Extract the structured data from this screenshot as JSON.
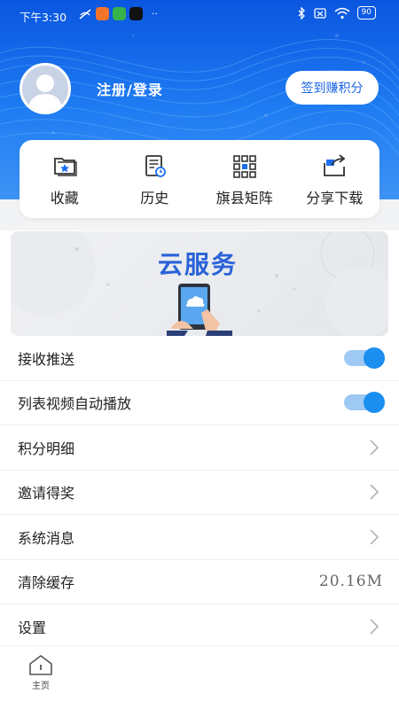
{
  "status_bar": {
    "time": "下午3:30",
    "battery": "90",
    "more": "··"
  },
  "user": {
    "login_text": "注册/登录",
    "signin_button": "签到赚积分"
  },
  "quick_actions": [
    {
      "label": "收藏",
      "icon": "favorites-folder-icon"
    },
    {
      "label": "历史",
      "icon": "history-icon"
    },
    {
      "label": "旗县矩阵",
      "icon": "grid-matrix-icon"
    },
    {
      "label": "分享下载",
      "icon": "share-icon"
    }
  ],
  "banner": {
    "title": "云服务"
  },
  "settings": [
    {
      "label": "接收推送",
      "control": "toggle",
      "on": true
    },
    {
      "label": "列表视频自动播放",
      "control": "toggle",
      "on": true
    },
    {
      "label": "积分明细",
      "control": "chevron"
    },
    {
      "label": "邀请得奖",
      "control": "chevron"
    },
    {
      "label": "系统消息",
      "control": "chevron"
    },
    {
      "label": "清除缓存",
      "control": "value",
      "value": "20.16M"
    },
    {
      "label": "设置",
      "control": "chevron"
    }
  ],
  "bottom_nav": {
    "home_label": "主页"
  },
  "colors": {
    "header_blue": "#1f7cf2",
    "accent_blue": "#1b8ff0",
    "toggle_track": "#9ec9f2"
  }
}
